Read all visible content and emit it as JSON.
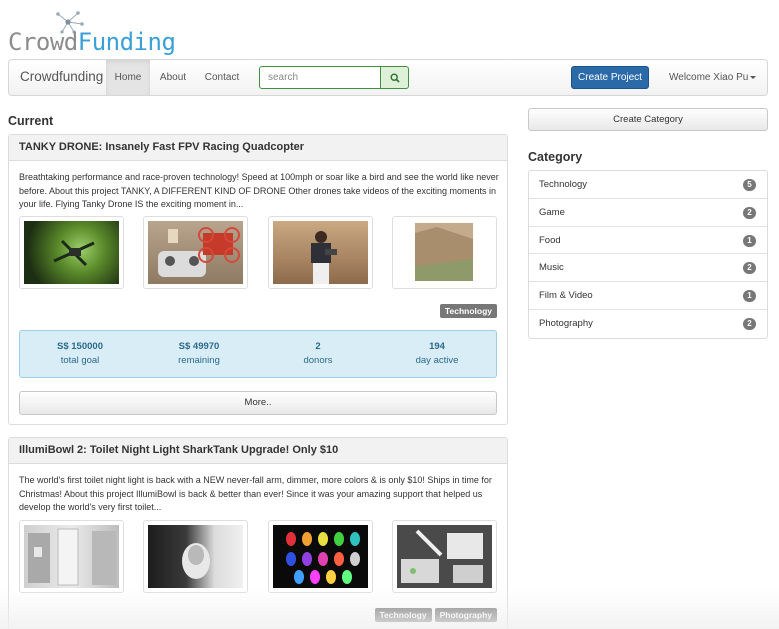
{
  "logo": {
    "crowd": "Crowd",
    "funding": "Funding"
  },
  "navbar": {
    "brand": "Crowdfunding",
    "links": {
      "home": "Home",
      "about": "About",
      "contact": "Contact"
    },
    "search_placeholder": "search",
    "search_icon": "search-icon",
    "create_project": "Create Project",
    "welcome": "Welcome Xiao Pu"
  },
  "main": {
    "heading": "Current",
    "projects": [
      {
        "title": "TANKY DRONE: Insanely Fast FPV Racing Quadcopter",
        "description": "Breathtaking performance and race-proven technology! Speed at 100mph or soar like a bird and see the world like never before. About this project TANKY, A DIFFERENT KIND OF DRONE Other drones take videos of the exciting moments in your life. Flying Tanky Drone IS the exciting moment in...",
        "tags": [
          "Technology"
        ],
        "stats": {
          "goal_value": "S$ 150000",
          "goal_label": "total goal",
          "remaining_value": "S$ 49970",
          "remaining_label": "remaining",
          "donors_value": "2",
          "donors_label": "donors",
          "days_value": "194",
          "days_label": "day active"
        },
        "more_label": "More.."
      },
      {
        "title": "IllumiBowl 2: Toilet Night Light SharkTank Upgrade! Only $10",
        "description": "The world's first toilet night light is back with a NEW never-fall arm, dimmer, more colors & is only $10! Ships in time for Christmas! About this project IllumiBowl is back & better than ever! Since it was your amazing support that helped us develop the world's very first toilet...",
        "tags": [
          "Technology",
          "Photography"
        ]
      }
    ]
  },
  "sidebar": {
    "create_category": "Create Category",
    "heading": "Category",
    "categories": [
      {
        "name": "Technology",
        "count": "5"
      },
      {
        "name": "Game",
        "count": "2"
      },
      {
        "name": "Food",
        "count": "1"
      },
      {
        "name": "Music",
        "count": "2"
      },
      {
        "name": "Film & Video",
        "count": "1"
      },
      {
        "name": "Photography",
        "count": "2"
      }
    ]
  },
  "colors": {
    "accent": "#2b6aa8",
    "logo_blue": "#3aa0d8",
    "stats_bg": "#d9edf7",
    "badge": "#777777"
  }
}
